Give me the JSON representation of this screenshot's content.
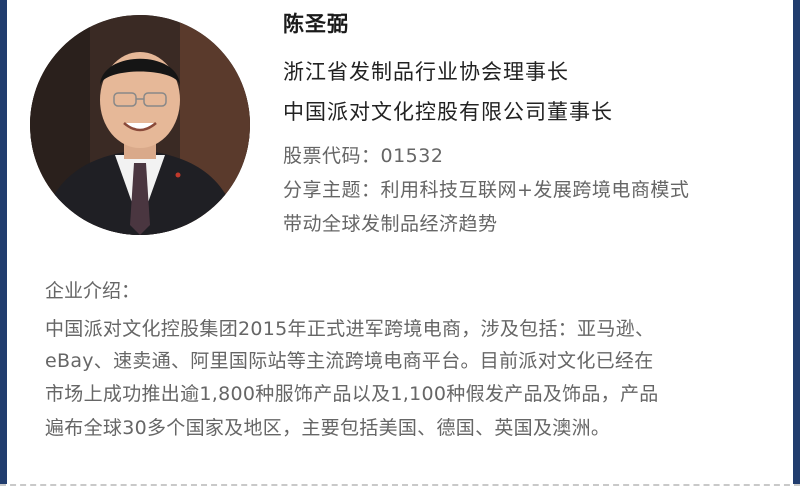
{
  "person": {
    "name": "陈圣弼",
    "titles": [
      "浙江省发制品行业协会理事长",
      "中国派对文化控股有限公司董事长"
    ],
    "stock_code": "股票代码：01532",
    "topic": [
      "分享主题：利用科技互联网+发展跨境电商模式",
      "带动全球发制品经济趋势"
    ]
  },
  "company": {
    "label": "企业介绍：",
    "lines": [
      "中国派对文化控股集团2015年正式进军跨境电商，涉及包括：亚马逊、",
      "eBay、速卖通、阿里国际站等主流跨境电商平台。目前派对文化已经在",
      "市场上成功推出逾1,800种服饰产品以及1,100种假发产品及饰品，产品",
      "遍布全球30多个国家及地区，主要包括美国、德国、英国及澳洲。"
    ]
  },
  "colors": {
    "border": "#213d6e",
    "text_dark": "#222222",
    "text_gray": "#666666"
  }
}
